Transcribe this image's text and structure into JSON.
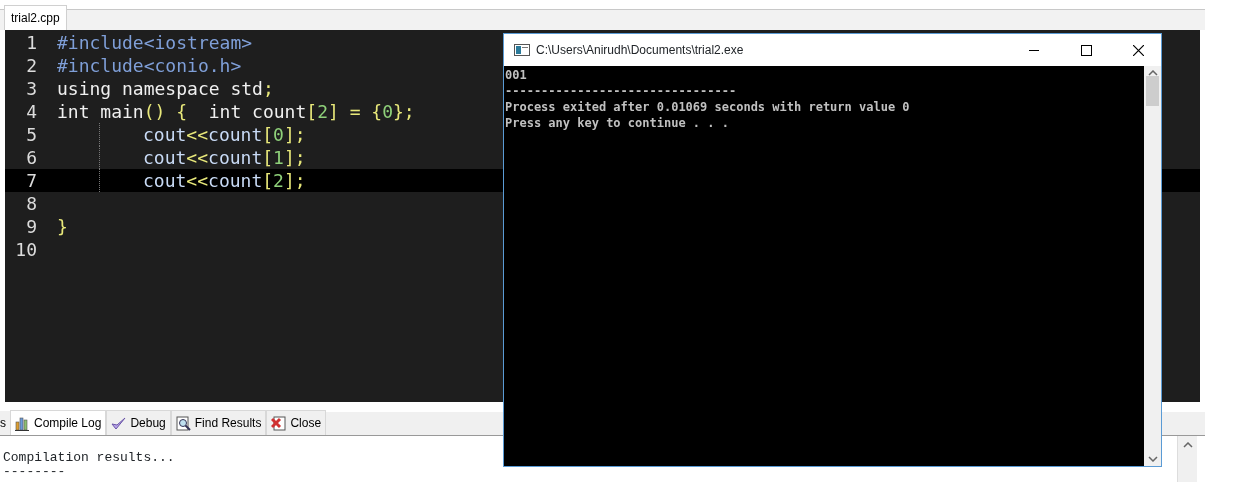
{
  "editor_tabs": [
    {
      "label": "trial2.cpp",
      "selected": true
    }
  ],
  "editor": {
    "lines": [
      {
        "number": "1",
        "selected": false,
        "tokens": [
          {
            "kind": "preproc",
            "text": "#include<iostream>"
          }
        ]
      },
      {
        "number": "2",
        "selected": false,
        "tokens": [
          {
            "kind": "preproc",
            "text": "#include<conio.h>"
          }
        ]
      },
      {
        "number": "3",
        "selected": false,
        "tokens": [
          {
            "kind": "word",
            "text": "using namespace std"
          },
          {
            "kind": "symbol",
            "text": ";"
          }
        ]
      },
      {
        "number": "4",
        "selected": false,
        "tokens": [
          {
            "kind": "word",
            "text": "int main"
          },
          {
            "kind": "symbol",
            "text": "() {  "
          },
          {
            "kind": "word",
            "text": "int count"
          },
          {
            "kind": "symbol",
            "text": "["
          },
          {
            "kind": "number",
            "text": "2"
          },
          {
            "kind": "symbol",
            "text": "] = {"
          },
          {
            "kind": "number",
            "text": "0"
          },
          {
            "kind": "symbol",
            "text": "};"
          }
        ],
        "children": [
          {
            "number": "5",
            "selected": false,
            "tokens": [
              {
                "kind": "ident",
                "text": "cout"
              },
              {
                "kind": "symbol",
                "text": "<<"
              },
              {
                "kind": "ident",
                "text": "count"
              },
              {
                "kind": "symbol",
                "text": "["
              },
              {
                "kind": "number",
                "text": "0"
              },
              {
                "kind": "symbol",
                "text": "];"
              }
            ]
          },
          {
            "number": "6",
            "selected": false,
            "tokens": [
              {
                "kind": "ident",
                "text": "cout"
              },
              {
                "kind": "symbol",
                "text": "<<"
              },
              {
                "kind": "ident",
                "text": "count"
              },
              {
                "kind": "symbol",
                "text": "["
              },
              {
                "kind": "number",
                "text": "1"
              },
              {
                "kind": "symbol",
                "text": "];"
              }
            ]
          },
          {
            "number": "7",
            "selected": true,
            "tokens": [
              {
                "kind": "ident",
                "text": "cout"
              },
              {
                "kind": "symbol",
                "text": "<<"
              },
              {
                "kind": "ident",
                "text": "count"
              },
              {
                "kind": "symbol",
                "text": "["
              },
              {
                "kind": "number",
                "text": "2"
              },
              {
                "kind": "symbol",
                "text": "];"
              }
            ]
          }
        ]
      },
      {
        "number": "8",
        "selected": false
      },
      {
        "number": "9",
        "selected": false,
        "tokens": [
          {
            "kind": "symbol",
            "text": "}"
          }
        ]
      },
      {
        "number": "10",
        "selected": false
      }
    ]
  },
  "bottom_tabs": [
    {
      "label": "s",
      "kind": "plain",
      "selected": false
    },
    {
      "label": "Compile Log",
      "kind": "log",
      "selected": true
    },
    {
      "label": "Debug",
      "kind": "debug",
      "selected": false
    },
    {
      "label": "Find Results",
      "kind": "find",
      "selected": false
    },
    {
      "label": "Close",
      "kind": "close",
      "selected": false
    }
  ],
  "compile_log": [
    "Compilation results...",
    "--------"
  ],
  "console": {
    "title": "C:\\Users\\Anirudh\\Documents\\trial2.exe",
    "output": [
      "001",
      "--------------------------------",
      "Process exited after 0.01069 seconds with return value 0",
      "Press any key to continue . . ."
    ]
  }
}
